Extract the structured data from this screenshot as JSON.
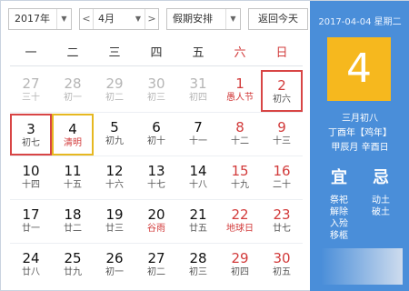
{
  "toolbar": {
    "year": "2017年",
    "month": "4月",
    "prev_symbol": "<",
    "next_symbol": ">",
    "holiday": "假期安排",
    "today_button": "返回今天",
    "dropdown_symbol": "▼"
  },
  "weekdays": [
    "一",
    "二",
    "三",
    "四",
    "五",
    "六",
    "日"
  ],
  "weeks": [
    [
      {
        "day": "27",
        "lunar": "三十",
        "muted": true
      },
      {
        "day": "28",
        "lunar": "初一",
        "muted": true
      },
      {
        "day": "29",
        "lunar": "初二",
        "muted": true
      },
      {
        "day": "30",
        "lunar": "初三",
        "muted": true
      },
      {
        "day": "31",
        "lunar": "初四",
        "muted": true
      },
      {
        "day": "1",
        "lunar": "愚人节",
        "weekend": true,
        "holiday": true
      },
      {
        "day": "2",
        "lunar": "初六",
        "weekend": true,
        "boxed": true
      }
    ],
    [
      {
        "day": "3",
        "lunar": "初七",
        "boxed": true
      },
      {
        "day": "4",
        "lunar": "清明",
        "today": true
      },
      {
        "day": "5",
        "lunar": "初九"
      },
      {
        "day": "6",
        "lunar": "初十"
      },
      {
        "day": "7",
        "lunar": "十一"
      },
      {
        "day": "8",
        "lunar": "十二",
        "weekend": true
      },
      {
        "day": "9",
        "lunar": "十三",
        "weekend": true
      }
    ],
    [
      {
        "day": "10",
        "lunar": "十四"
      },
      {
        "day": "11",
        "lunar": "十五"
      },
      {
        "day": "12",
        "lunar": "十六"
      },
      {
        "day": "13",
        "lunar": "十七"
      },
      {
        "day": "14",
        "lunar": "十八"
      },
      {
        "day": "15",
        "lunar": "十九",
        "weekend": true
      },
      {
        "day": "16",
        "lunar": "二十",
        "weekend": true
      }
    ],
    [
      {
        "day": "17",
        "lunar": "廿一"
      },
      {
        "day": "18",
        "lunar": "廿二"
      },
      {
        "day": "19",
        "lunar": "廿三"
      },
      {
        "day": "20",
        "lunar": "谷雨",
        "term": true
      },
      {
        "day": "21",
        "lunar": "廿五"
      },
      {
        "day": "22",
        "lunar": "地球日",
        "weekend": true,
        "holiday": true
      },
      {
        "day": "23",
        "lunar": "廿七",
        "weekend": true
      }
    ],
    [
      {
        "day": "24",
        "lunar": "廿八"
      },
      {
        "day": "25",
        "lunar": "廿九"
      },
      {
        "day": "26",
        "lunar": "初一"
      },
      {
        "day": "27",
        "lunar": "初二"
      },
      {
        "day": "28",
        "lunar": "初三"
      },
      {
        "day": "29",
        "lunar": "初四",
        "weekend": true
      },
      {
        "day": "30",
        "lunar": "初五",
        "weekend": true
      }
    ]
  ],
  "panel": {
    "date_line": "2017-04-04 星期二",
    "big_day": "4",
    "lunar_date": "三月初八",
    "year_info": "丁酉年【鸡年】",
    "month_day_info": "甲辰月 辛酉日",
    "yi_title": "宜",
    "ji_title": "忌",
    "yi_items": [
      "祭祀",
      "解除",
      "入殓",
      "移柩"
    ],
    "ji_items": [
      "动土",
      "破土"
    ]
  },
  "colors": {
    "panel_blue": "#4a8ed9",
    "today_gold": "#f6b81e",
    "weekend_red": "#d23b3b",
    "box_red": "#d84545"
  }
}
